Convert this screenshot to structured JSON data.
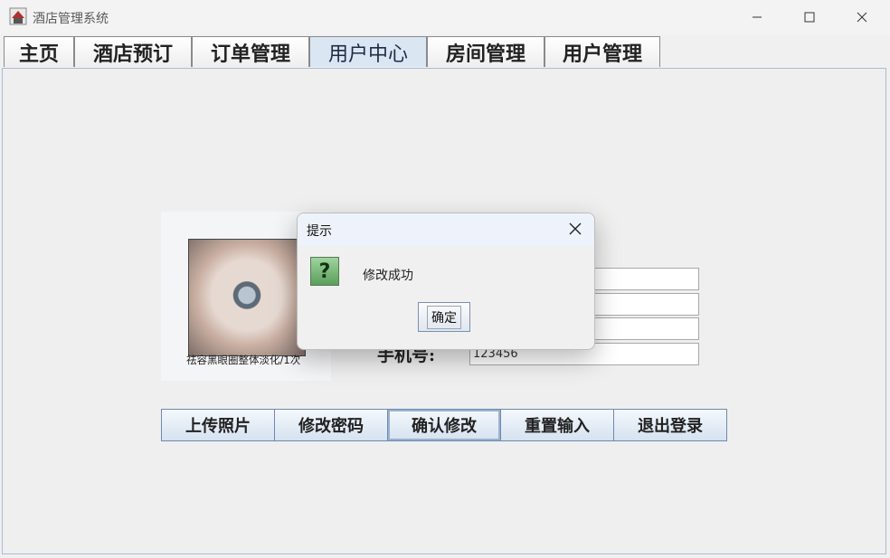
{
  "window": {
    "title": "酒店管理系统"
  },
  "tabs": [
    {
      "label": "主页"
    },
    {
      "label": "酒店预订"
    },
    {
      "label": "订单管理"
    },
    {
      "label": "用户中心"
    },
    {
      "label": "房间管理"
    },
    {
      "label": "用户管理"
    }
  ],
  "active_tab": "用户中心",
  "photo": {
    "caption": "祛容黑眼圈整体淡化/1次"
  },
  "form": {
    "phone_label": "手机号:",
    "field1_value": "",
    "field2_value": "",
    "field3_value": "",
    "phone_value": "123456"
  },
  "buttons": {
    "upload": "上传照片",
    "change_password": "修改密码",
    "confirm": "确认修改",
    "reset": "重置输入",
    "logout": "退出登录"
  },
  "dialog": {
    "title": "提示",
    "message": "修改成功",
    "ok": "确定",
    "icon": "question-icon"
  },
  "colors": {
    "active_tab": "#dbe6f3",
    "button_border": "#6d8ab0"
  }
}
